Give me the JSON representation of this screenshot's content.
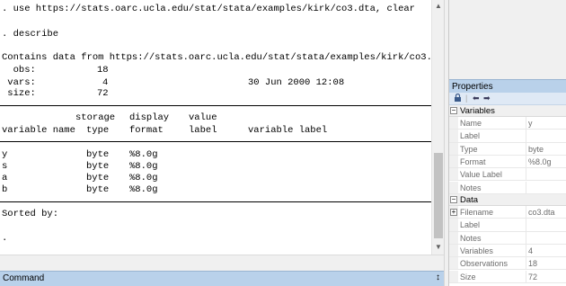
{
  "results": {
    "cmd_use": ". use https://stats.oarc.ucla.edu/stat/stata/examples/kirk/co3.dta, clear",
    "cmd_describe": ". describe",
    "contains": "Contains data from https://stats.oarc.ucla.edu/stat/stata/examples/kirk/co3.dta",
    "obs_label": "  obs:",
    "obs_value": "18",
    "vars_label": " vars:",
    "vars_value": "4",
    "date": "30 Jun 2000 12:08",
    "size_label": " size:",
    "size_value": "72",
    "head1": {
      "storage": "storage",
      "display": "display",
      "value": "value"
    },
    "head2": {
      "variable_name": "variable name",
      "type": "type",
      "format": "format",
      "label": "label",
      "variable_label": "variable label"
    },
    "variables": [
      {
        "name": "y",
        "type": "byte",
        "format": "%8.0g"
      },
      {
        "name": "s",
        "type": "byte",
        "format": "%8.0g"
      },
      {
        "name": "a",
        "type": "byte",
        "format": "%8.0g"
      },
      {
        "name": "b",
        "type": "byte",
        "format": "%8.0g"
      }
    ],
    "sorted_by": "Sorted by:",
    "prompt": "."
  },
  "command_bar": {
    "title": "Command",
    "pin": "↕"
  },
  "properties": {
    "title": "Properties",
    "toolbar_icons": [
      "lock-icon",
      "back-arrow-icon",
      "forward-arrow-icon"
    ],
    "variables_section": "Variables",
    "variables_rows": [
      {
        "key": "Name",
        "value": "y"
      },
      {
        "key": "Label",
        "value": ""
      },
      {
        "key": "Type",
        "value": "byte"
      },
      {
        "key": "Format",
        "value": "%8.0g"
      },
      {
        "key": "Value Label",
        "value": ""
      },
      {
        "key": "Notes",
        "value": ""
      }
    ],
    "data_section": "Data",
    "data_rows": [
      {
        "key": "Filename",
        "value": "co3.dta"
      },
      {
        "key": "Label",
        "value": ""
      },
      {
        "key": "Notes",
        "value": ""
      },
      {
        "key": "Variables",
        "value": "4"
      },
      {
        "key": "Observations",
        "value": "18"
      },
      {
        "key": "Size",
        "value": "72"
      }
    ]
  }
}
